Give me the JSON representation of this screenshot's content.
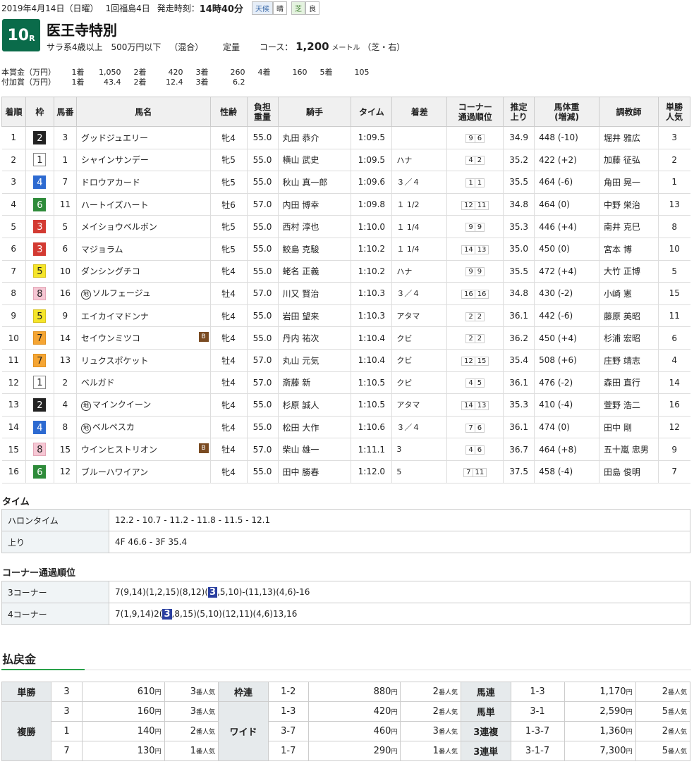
{
  "header": {
    "date": "2019年4月14日（日曜）",
    "meeting": "1回福島4日",
    "start_label": "発走時刻：",
    "start_time": "14時40分",
    "weather_label": "天候",
    "weather": "晴",
    "track_label": "芝",
    "track_cond": "良"
  },
  "race": {
    "number": "10",
    "number_suffix": "R",
    "name": "医王寺特別",
    "class": "サラ系4歳以上",
    "condition": "500万円以下",
    "mixed": "（混合）",
    "weight_rule": "定量",
    "course_label": "コース：",
    "distance": "1,200",
    "distance_unit": "メートル",
    "course_detail": "（芝・右）"
  },
  "prize_main": {
    "label": "本賞金（万円）",
    "items": [
      {
        "place": "1着",
        "value": "1,050"
      },
      {
        "place": "2着",
        "value": "420"
      },
      {
        "place": "3着",
        "value": "260"
      },
      {
        "place": "4着",
        "value": "160"
      },
      {
        "place": "5着",
        "value": "105"
      }
    ]
  },
  "prize_extra": {
    "label": "付加賞（万円）",
    "items": [
      {
        "place": "1着",
        "value": "43.4"
      },
      {
        "place": "2着",
        "value": "12.4"
      },
      {
        "place": "3着",
        "value": "6.2"
      }
    ]
  },
  "results_headers": [
    "着順",
    "枠",
    "馬番",
    "馬名",
    "性齢",
    "負担\n重量",
    "騎手",
    "タイム",
    "着差",
    "コーナー\n通過順位",
    "推定\n上り",
    "馬体重\n(増減)",
    "調教師",
    "単勝\n人気"
  ],
  "results": [
    {
      "pos": "1",
      "waku": "2",
      "num": "3",
      "horse": "グッドジュエリー",
      "chi": "",
      "blink": "",
      "sex_age": "牝4",
      "weight": "55.0",
      "jockey": "丸田 恭介",
      "time": "1:09.5",
      "margin": "",
      "c3": "9",
      "c4": "6",
      "last3f": "34.9",
      "body": "448 (-10)",
      "trainer": "堀井 雅広",
      "fav": "3"
    },
    {
      "pos": "2",
      "waku": "1",
      "num": "1",
      "horse": "シャインサンデー",
      "chi": "",
      "blink": "",
      "sex_age": "牝5",
      "weight": "55.0",
      "jockey": "横山 武史",
      "time": "1:09.5",
      "margin": "ハナ",
      "c3": "4",
      "c4": "2",
      "last3f": "35.2",
      "body": "422 (+2)",
      "trainer": "加藤 征弘",
      "fav": "2"
    },
    {
      "pos": "3",
      "waku": "4",
      "num": "7",
      "horse": "ドロウアカード",
      "chi": "",
      "blink": "",
      "sex_age": "牝5",
      "weight": "55.0",
      "jockey": "秋山 真一郎",
      "time": "1:09.6",
      "margin": "３／４",
      "c3": "1",
      "c4": "1",
      "last3f": "35.5",
      "body": "464 (-6)",
      "trainer": "角田 晃一",
      "fav": "1"
    },
    {
      "pos": "4",
      "waku": "6",
      "num": "11",
      "horse": "ハートイズハート",
      "chi": "",
      "blink": "",
      "sex_age": "牡6",
      "weight": "57.0",
      "jockey": "内田 博幸",
      "time": "1:09.8",
      "margin": "１ 1/2",
      "c3": "12",
      "c4": "11",
      "last3f": "34.8",
      "body": "464 (0)",
      "trainer": "中野 栄治",
      "fav": "13"
    },
    {
      "pos": "5",
      "waku": "3",
      "num": "5",
      "horse": "メイショウベルボン",
      "chi": "",
      "blink": "",
      "sex_age": "牝5",
      "weight": "55.0",
      "jockey": "西村 淳也",
      "time": "1:10.0",
      "margin": "１ 1/4",
      "c3": "9",
      "c4": "9",
      "last3f": "35.3",
      "body": "446 (+4)",
      "trainer": "南井 克巳",
      "fav": "8"
    },
    {
      "pos": "6",
      "waku": "3",
      "num": "6",
      "horse": "マジョラム",
      "chi": "",
      "blink": "",
      "sex_age": "牝5",
      "weight": "55.0",
      "jockey": "鮫島 克駿",
      "time": "1:10.2",
      "margin": "１ 1/4",
      "c3": "14",
      "c4": "13",
      "last3f": "35.0",
      "body": "450 (0)",
      "trainer": "宮本 博",
      "fav": "10"
    },
    {
      "pos": "7",
      "waku": "5",
      "num": "10",
      "horse": "ダンシングチコ",
      "chi": "",
      "blink": "",
      "sex_age": "牝4",
      "weight": "55.0",
      "jockey": "蛯名 正義",
      "time": "1:10.2",
      "margin": "ハナ",
      "c3": "9",
      "c4": "9",
      "last3f": "35.5",
      "body": "472 (+4)",
      "trainer": "大竹 正博",
      "fav": "5"
    },
    {
      "pos": "8",
      "waku": "8",
      "num": "16",
      "horse": "ソルフェージュ",
      "chi": "地",
      "blink": "",
      "sex_age": "牡4",
      "weight": "57.0",
      "jockey": "川又 賢治",
      "time": "1:10.3",
      "margin": "３／４",
      "c3": "16",
      "c4": "16",
      "last3f": "34.8",
      "body": "430 (-2)",
      "trainer": "小崎 憲",
      "fav": "15"
    },
    {
      "pos": "9",
      "waku": "5",
      "num": "9",
      "horse": "エイカイマドンナ",
      "chi": "",
      "blink": "",
      "sex_age": "牝4",
      "weight": "55.0",
      "jockey": "岩田 望来",
      "time": "1:10.3",
      "margin": "アタマ",
      "c3": "2",
      "c4": "2",
      "last3f": "36.1",
      "body": "442 (-6)",
      "trainer": "藤原 英昭",
      "fav": "11"
    },
    {
      "pos": "10",
      "waku": "7",
      "num": "14",
      "horse": "セイウンミツコ",
      "chi": "",
      "blink": "B",
      "sex_age": "牝4",
      "weight": "55.0",
      "jockey": "丹内 祐次",
      "time": "1:10.4",
      "margin": "クビ",
      "c3": "2",
      "c4": "2",
      "last3f": "36.2",
      "body": "450 (+4)",
      "trainer": "杉浦 宏昭",
      "fav": "6"
    },
    {
      "pos": "11",
      "waku": "7",
      "num": "13",
      "horse": "リュクスポケット",
      "chi": "",
      "blink": "",
      "sex_age": "牡4",
      "weight": "57.0",
      "jockey": "丸山 元気",
      "time": "1:10.4",
      "margin": "クビ",
      "c3": "12",
      "c4": "15",
      "last3f": "35.4",
      "body": "508 (+6)",
      "trainer": "庄野 靖志",
      "fav": "4"
    },
    {
      "pos": "12",
      "waku": "1",
      "num": "2",
      "horse": "ベルガド",
      "chi": "",
      "blink": "",
      "sex_age": "牡4",
      "weight": "57.0",
      "jockey": "斎藤 新",
      "time": "1:10.5",
      "margin": "クビ",
      "c3": "4",
      "c4": "5",
      "last3f": "36.1",
      "body": "476 (-2)",
      "trainer": "森田 直行",
      "fav": "14"
    },
    {
      "pos": "13",
      "waku": "2",
      "num": "4",
      "horse": "マインクイーン",
      "chi": "地",
      "blink": "",
      "sex_age": "牝4",
      "weight": "55.0",
      "jockey": "杉原 誠人",
      "time": "1:10.5",
      "margin": "アタマ",
      "c3": "14",
      "c4": "13",
      "last3f": "35.3",
      "body": "410 (-4)",
      "trainer": "萱野 浩二",
      "fav": "16"
    },
    {
      "pos": "14",
      "waku": "4",
      "num": "8",
      "horse": "ベルペスカ",
      "chi": "地",
      "blink": "",
      "sex_age": "牝4",
      "weight": "55.0",
      "jockey": "松田 大作",
      "time": "1:10.6",
      "margin": "３／４",
      "c3": "7",
      "c4": "6",
      "last3f": "36.1",
      "body": "474 (0)",
      "trainer": "田中 剛",
      "fav": "12"
    },
    {
      "pos": "15",
      "waku": "8",
      "num": "15",
      "horse": "ウインヒストリオン",
      "chi": "",
      "blink": "B",
      "sex_age": "牡4",
      "weight": "57.0",
      "jockey": "柴山 雄一",
      "time": "1:11.1",
      "margin": "3",
      "c3": "4",
      "c4": "6",
      "last3f": "36.7",
      "body": "464 (+8)",
      "trainer": "五十嵐 忠男",
      "fav": "9"
    },
    {
      "pos": "16",
      "waku": "6",
      "num": "12",
      "horse": "ブルーハワイアン",
      "chi": "",
      "blink": "",
      "sex_age": "牝4",
      "weight": "55.0",
      "jockey": "田中 勝春",
      "time": "1:12.0",
      "margin": "5",
      "c3": "7",
      "c4": "11",
      "last3f": "37.5",
      "body": "458 (-4)",
      "trainer": "田島 俊明",
      "fav": "7"
    }
  ],
  "time_section": {
    "title": "タイム",
    "rows": [
      {
        "key": "ハロンタイム",
        "value": "12.2 - 10.7 - 11.2 - 11.8 - 11.5 - 12.1"
      },
      {
        "key": "上り",
        "value": "4F 46.6 - 3F 35.4"
      }
    ]
  },
  "corner_section": {
    "title": "コーナー通過順位",
    "rows": [
      {
        "key": "3コーナー",
        "before": "7(9,14)(1,2,15)(8,12)(",
        "hl": "3",
        "after": ",5,10)-(11,13)(4,6)-16"
      },
      {
        "key": "4コーナー",
        "before": "7(1,9,14)2(",
        "hl": "3",
        "after": ",8,15)(5,10)(12,11)(4,6)13,16"
      }
    ]
  },
  "payout": {
    "title": "払戻金",
    "yen": "円",
    "pop": "番人気",
    "tansho": {
      "label": "単勝",
      "num": "3",
      "amount": "610",
      "rank": "3"
    },
    "fukusho": {
      "label": "複勝",
      "rows": [
        {
          "num": "3",
          "amount": "160",
          "rank": "3"
        },
        {
          "num": "1",
          "amount": "140",
          "rank": "2"
        },
        {
          "num": "7",
          "amount": "130",
          "rank": "1"
        }
      ]
    },
    "wakuren": {
      "label": "枠連",
      "num": "1-2",
      "amount": "880",
      "rank": "2"
    },
    "wide": {
      "label": "ワイド",
      "rows": [
        {
          "num": "1-3",
          "amount": "420",
          "rank": "2"
        },
        {
          "num": "3-7",
          "amount": "460",
          "rank": "3"
        },
        {
          "num": "1-7",
          "amount": "290",
          "rank": "1"
        }
      ]
    },
    "umaren": {
      "label": "馬連",
      "num": "1-3",
      "amount": "1,170",
      "rank": "2"
    },
    "umatan": {
      "label": "馬単",
      "num": "3-1",
      "amount": "2,590",
      "rank": "5"
    },
    "sanrenpuku": {
      "label": "3連複",
      "num": "1-3-7",
      "amount": "1,360",
      "rank": "2"
    },
    "sanrentan": {
      "label": "3連単",
      "num": "3-1-7",
      "amount": "7,300",
      "rank": "5"
    }
  }
}
